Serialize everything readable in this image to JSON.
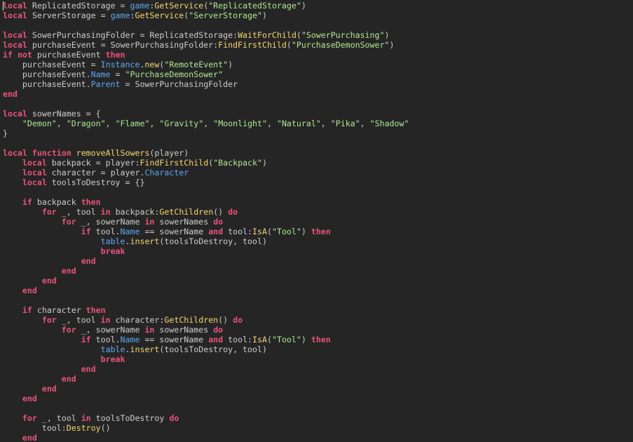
{
  "editor": {
    "language": "lua",
    "background": "#252526",
    "colors": {
      "keyword": "#e8537a",
      "function": "#f5d66b",
      "string": "#aee88f",
      "property": "#5fa8f0",
      "identifier": "#cccccc"
    },
    "lines": [
      [
        [
          "k",
          "local"
        ],
        [
          "t",
          " ReplicatedStorage = "
        ],
        [
          "p",
          "game"
        ],
        [
          "t",
          ":"
        ],
        [
          "f",
          "GetService"
        ],
        [
          "t",
          "("
        ],
        [
          "s",
          "\"ReplicatedStorage\""
        ],
        [
          "t",
          ")"
        ]
      ],
      [
        [
          "k",
          "local"
        ],
        [
          "t",
          " ServerStorage = "
        ],
        [
          "p",
          "game"
        ],
        [
          "t",
          ":"
        ],
        [
          "f",
          "GetService"
        ],
        [
          "t",
          "("
        ],
        [
          "s",
          "\"ServerStorage\""
        ],
        [
          "t",
          ")"
        ]
      ],
      [],
      [
        [
          "k",
          "local"
        ],
        [
          "t",
          " SowerPurchasingFolder = ReplicatedStorage:"
        ],
        [
          "f",
          "WaitForChild"
        ],
        [
          "t",
          "("
        ],
        [
          "s",
          "\"SowerPurchasing\""
        ],
        [
          "t",
          ")"
        ]
      ],
      [
        [
          "k",
          "local"
        ],
        [
          "t",
          " purchaseEvent = SowerPurchasingFolder:"
        ],
        [
          "f",
          "FindFirstChild"
        ],
        [
          "t",
          "("
        ],
        [
          "s",
          "\"PurchaseDemonSower\""
        ],
        [
          "t",
          ")"
        ]
      ],
      [
        [
          "k",
          "if"
        ],
        [
          "t",
          " "
        ],
        [
          "k",
          "not"
        ],
        [
          "t",
          " purchaseEvent "
        ],
        [
          "k",
          "then"
        ]
      ],
      [
        [
          "t",
          "    purchaseEvent = "
        ],
        [
          "p",
          "Instance"
        ],
        [
          "t",
          "."
        ],
        [
          "f",
          "new"
        ],
        [
          "t",
          "("
        ],
        [
          "s",
          "\"RemoteEvent\""
        ],
        [
          "t",
          ")"
        ]
      ],
      [
        [
          "t",
          "    purchaseEvent."
        ],
        [
          "p",
          "Name"
        ],
        [
          "t",
          " = "
        ],
        [
          "s",
          "\"PurchaseDemonSower\""
        ]
      ],
      [
        [
          "t",
          "    purchaseEvent."
        ],
        [
          "p",
          "Parent"
        ],
        [
          "t",
          " = SowerPurchasingFolder"
        ]
      ],
      [
        [
          "k",
          "end"
        ]
      ],
      [],
      [
        [
          "k",
          "local"
        ],
        [
          "t",
          " sowerNames = {"
        ]
      ],
      [
        [
          "t",
          "    "
        ],
        [
          "s",
          "\"Demon\""
        ],
        [
          "t",
          ", "
        ],
        [
          "s",
          "\"Dragon\""
        ],
        [
          "t",
          ", "
        ],
        [
          "s",
          "\"Flame\""
        ],
        [
          "t",
          ", "
        ],
        [
          "s",
          "\"Gravity\""
        ],
        [
          "t",
          ", "
        ],
        [
          "s",
          "\"Moonlight\""
        ],
        [
          "t",
          ", "
        ],
        [
          "s",
          "\"Natural\""
        ],
        [
          "t",
          ", "
        ],
        [
          "s",
          "\"Pika\""
        ],
        [
          "t",
          ", "
        ],
        [
          "s",
          "\"Shadow\""
        ]
      ],
      [
        [
          "t",
          "}"
        ]
      ],
      [],
      [
        [
          "k",
          "local"
        ],
        [
          "t",
          " "
        ],
        [
          "k",
          "function"
        ],
        [
          "t",
          " "
        ],
        [
          "f",
          "removeAllSowers"
        ],
        [
          "t",
          "(player)"
        ]
      ],
      [
        [
          "t",
          "    "
        ],
        [
          "k",
          "local"
        ],
        [
          "t",
          " backpack = player:"
        ],
        [
          "f",
          "FindFirstChild"
        ],
        [
          "t",
          "("
        ],
        [
          "s",
          "\"Backpack\""
        ],
        [
          "t",
          ")"
        ]
      ],
      [
        [
          "t",
          "    "
        ],
        [
          "k",
          "local"
        ],
        [
          "t",
          " character = player."
        ],
        [
          "p",
          "Character"
        ]
      ],
      [
        [
          "t",
          "    "
        ],
        [
          "k",
          "local"
        ],
        [
          "t",
          " toolsToDestroy = {}"
        ]
      ],
      [],
      [
        [
          "t",
          "    "
        ],
        [
          "k",
          "if"
        ],
        [
          "t",
          " backpack "
        ],
        [
          "k",
          "then"
        ]
      ],
      [
        [
          "t",
          "        "
        ],
        [
          "k",
          "for"
        ],
        [
          "t",
          " _, tool "
        ],
        [
          "k",
          "in"
        ],
        [
          "t",
          " backpack:"
        ],
        [
          "f",
          "GetChildren"
        ],
        [
          "t",
          "() "
        ],
        [
          "k",
          "do"
        ]
      ],
      [
        [
          "t",
          "            "
        ],
        [
          "k",
          "for"
        ],
        [
          "t",
          " _, sowerName "
        ],
        [
          "k",
          "in"
        ],
        [
          "t",
          " sowerNames "
        ],
        [
          "k",
          "do"
        ]
      ],
      [
        [
          "t",
          "                "
        ],
        [
          "k",
          "if"
        ],
        [
          "t",
          " tool."
        ],
        [
          "p",
          "Name"
        ],
        [
          "t",
          " == sowerName "
        ],
        [
          "k",
          "and"
        ],
        [
          "t",
          " tool:"
        ],
        [
          "f",
          "IsA"
        ],
        [
          "t",
          "("
        ],
        [
          "s",
          "\"Tool\""
        ],
        [
          "t",
          ") "
        ],
        [
          "k",
          "then"
        ]
      ],
      [
        [
          "t",
          "                    "
        ],
        [
          "p",
          "table"
        ],
        [
          "t",
          "."
        ],
        [
          "f",
          "insert"
        ],
        [
          "t",
          "(toolsToDestroy, tool)"
        ]
      ],
      [
        [
          "t",
          "                    "
        ],
        [
          "k",
          "break"
        ]
      ],
      [
        [
          "t",
          "                "
        ],
        [
          "k",
          "end"
        ]
      ],
      [
        [
          "t",
          "            "
        ],
        [
          "k",
          "end"
        ]
      ],
      [
        [
          "t",
          "        "
        ],
        [
          "k",
          "end"
        ]
      ],
      [
        [
          "t",
          "    "
        ],
        [
          "k",
          "end"
        ]
      ],
      [],
      [
        [
          "t",
          "    "
        ],
        [
          "k",
          "if"
        ],
        [
          "t",
          " character "
        ],
        [
          "k",
          "then"
        ]
      ],
      [
        [
          "t",
          "        "
        ],
        [
          "k",
          "for"
        ],
        [
          "t",
          " _, tool "
        ],
        [
          "k",
          "in"
        ],
        [
          "t",
          " character:"
        ],
        [
          "f",
          "GetChildren"
        ],
        [
          "t",
          "() "
        ],
        [
          "k",
          "do"
        ]
      ],
      [
        [
          "t",
          "            "
        ],
        [
          "k",
          "for"
        ],
        [
          "t",
          " _, sowerName "
        ],
        [
          "k",
          "in"
        ],
        [
          "t",
          " sowerNames "
        ],
        [
          "k",
          "do"
        ]
      ],
      [
        [
          "t",
          "                "
        ],
        [
          "k",
          "if"
        ],
        [
          "t",
          " tool."
        ],
        [
          "p",
          "Name"
        ],
        [
          "t",
          " == sowerName "
        ],
        [
          "k",
          "and"
        ],
        [
          "t",
          " tool:"
        ],
        [
          "f",
          "IsA"
        ],
        [
          "t",
          "("
        ],
        [
          "s",
          "\"Tool\""
        ],
        [
          "t",
          ") "
        ],
        [
          "k",
          "then"
        ]
      ],
      [
        [
          "t",
          "                    "
        ],
        [
          "p",
          "table"
        ],
        [
          "t",
          "."
        ],
        [
          "f",
          "insert"
        ],
        [
          "t",
          "(toolsToDestroy, tool)"
        ]
      ],
      [
        [
          "t",
          "                    "
        ],
        [
          "k",
          "break"
        ]
      ],
      [
        [
          "t",
          "                "
        ],
        [
          "k",
          "end"
        ]
      ],
      [
        [
          "t",
          "            "
        ],
        [
          "k",
          "end"
        ]
      ],
      [
        [
          "t",
          "        "
        ],
        [
          "k",
          "end"
        ]
      ],
      [
        [
          "t",
          "    "
        ],
        [
          "k",
          "end"
        ]
      ],
      [],
      [
        [
          "t",
          "    "
        ],
        [
          "k",
          "for"
        ],
        [
          "t",
          " _, tool "
        ],
        [
          "k",
          "in"
        ],
        [
          "t",
          " toolsToDestroy "
        ],
        [
          "k",
          "do"
        ]
      ],
      [
        [
          "t",
          "        tool:"
        ],
        [
          "f",
          "Destroy"
        ],
        [
          "t",
          "()"
        ]
      ],
      [
        [
          "t",
          "    "
        ],
        [
          "k",
          "end"
        ]
      ]
    ]
  }
}
